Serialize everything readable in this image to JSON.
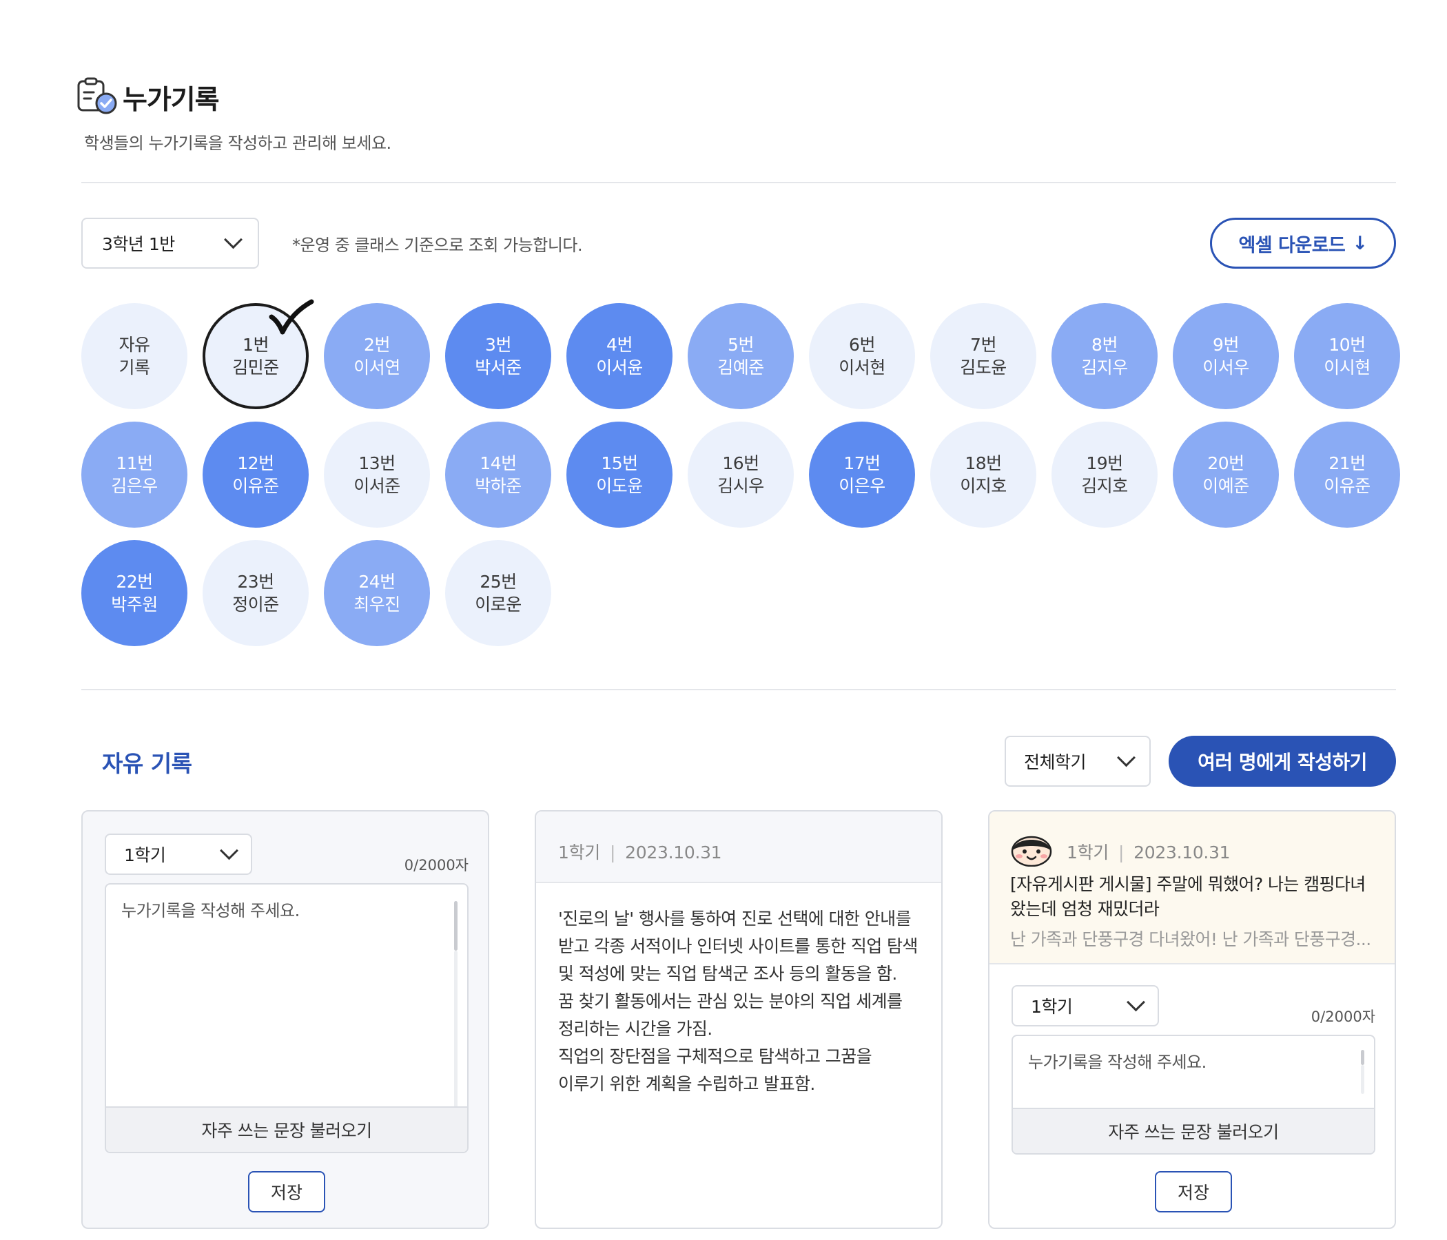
{
  "header": {
    "title": "누가기록",
    "subtitle": "학생들의 누가기록을 작성하고 관리해 보세요."
  },
  "toolbar": {
    "class_select": "3학년 1반",
    "note": "*운영 중 클래스 기준으로 조회 가능합니다.",
    "excel_button": "엑셀 다운로드"
  },
  "students": [
    {
      "line1": "자유",
      "line2": "기록",
      "level": 0
    },
    {
      "line1": "1번",
      "line2": "김민준",
      "level": 0,
      "selected": true
    },
    {
      "line1": "2번",
      "line2": "이서연",
      "level": 1
    },
    {
      "line1": "3번",
      "line2": "박서준",
      "level": 2
    },
    {
      "line1": "4번",
      "line2": "이서윤",
      "level": 2
    },
    {
      "line1": "5번",
      "line2": "김예준",
      "level": 1
    },
    {
      "line1": "6번",
      "line2": "이서현",
      "level": 0
    },
    {
      "line1": "7번",
      "line2": "김도윤",
      "level": 0
    },
    {
      "line1": "8번",
      "line2": "김지우",
      "level": 1
    },
    {
      "line1": "9번",
      "line2": "이서우",
      "level": 1
    },
    {
      "line1": "10번",
      "line2": "이시현",
      "level": 1
    },
    {
      "line1": "11번",
      "line2": "김은우",
      "level": 1
    },
    {
      "line1": "12번",
      "line2": "이유준",
      "level": 2
    },
    {
      "line1": "13번",
      "line2": "이서준",
      "level": 0
    },
    {
      "line1": "14번",
      "line2": "박하준",
      "level": 1
    },
    {
      "line1": "15번",
      "line2": "이도윤",
      "level": 2
    },
    {
      "line1": "16번",
      "line2": "김시우",
      "level": 0
    },
    {
      "line1": "17번",
      "line2": "이은우",
      "level": 2
    },
    {
      "line1": "18번",
      "line2": "이지호",
      "level": 0
    },
    {
      "line1": "19번",
      "line2": "김지호",
      "level": 0
    },
    {
      "line1": "20번",
      "line2": "이예준",
      "level": 1
    },
    {
      "line1": "21번",
      "line2": "이유준",
      "level": 1
    },
    {
      "line1": "22번",
      "line2": "박주원",
      "level": 2
    },
    {
      "line1": "23번",
      "line2": "정이준",
      "level": 0
    },
    {
      "line1": "24번",
      "line2": "최우진",
      "level": 1
    },
    {
      "line1": "25번",
      "line2": "이로운",
      "level": 0
    }
  ],
  "section": {
    "title": "자유 기록",
    "semester_filter": "전체학기",
    "multi_button": "여러 명에게 작성하기"
  },
  "editor_card": {
    "semester": "1학기",
    "count": "0/2000자",
    "placeholder": "누가기록을 작성해 주세요.",
    "load_sentences": "자주 쓰는 문장 불러오기",
    "save": "저장"
  },
  "record_card": {
    "semester": "1학기",
    "date": "2023.10.31",
    "text": "'진로의 날' 행사를 통하여 진로 선택에 대한 안내를\n받고 각종 서적이나 인터넷 사이트를 통한 직업 탐색\n및 적성에 맞는 직업 탐색군 조사 등의 활동을 함.\n꿈 찾기 활동에서는 관심 있는 분야의 직업 세계를\n정리하는 시간을 가짐.\n직업의 장단점을 구체적으로 탐색하고 그꿈을\n이루기 위한 계획을 수립하고 발표함."
  },
  "post_card": {
    "semester": "1학기",
    "date": "2023.10.31",
    "title": "[자유게시판 게시물] 주말에 뭐했어? 나는 캠핑다녀\n왔는데 엄청 재밌더라",
    "preview": "난 가족과 단풍구경 다녀왔어! 난 가족과 단풍구경...",
    "editor": {
      "semester": "1학기",
      "count": "0/2000자",
      "placeholder": "누가기록을 작성해 주세요.",
      "load_sentences": "자주 쓰는 문장 불러오기",
      "save": "저장"
    }
  },
  "colors": {
    "accent": "#2a53b5",
    "level0": "#ebf1fc",
    "level1": "#8aabf4",
    "level2": "#5d8bf0",
    "post_bg": "#fdf9ef"
  },
  "icons": [
    "record-clipboard-icon",
    "chevron-down-icon",
    "download-arrow-icon",
    "check-mark-icon",
    "avatar-face-icon"
  ]
}
